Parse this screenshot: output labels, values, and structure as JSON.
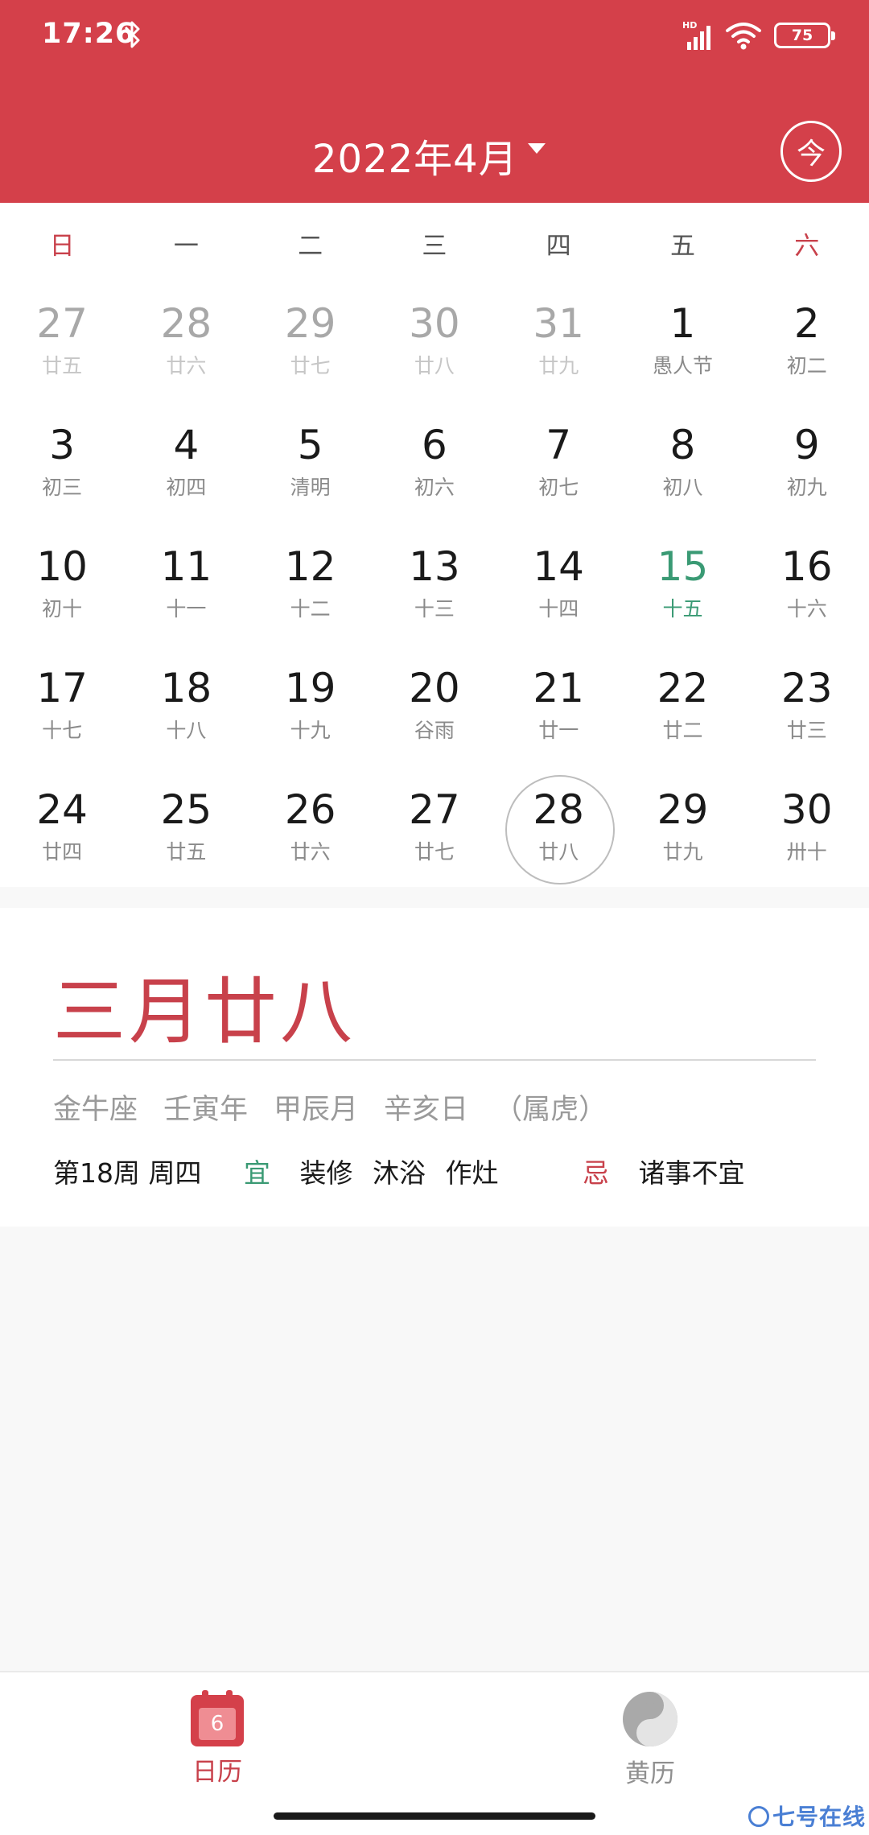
{
  "status_bar": {
    "time": "17:26",
    "network": "HD",
    "battery": "75"
  },
  "header": {
    "title": "2022年4月",
    "today_button": "今"
  },
  "weekdays": [
    "日",
    "一",
    "二",
    "三",
    "四",
    "五",
    "六"
  ],
  "days": [
    {
      "day": "27",
      "lunar": "廿五",
      "state": "prev"
    },
    {
      "day": "28",
      "lunar": "廿六",
      "state": "prev"
    },
    {
      "day": "29",
      "lunar": "廿七",
      "state": "prev"
    },
    {
      "day": "30",
      "lunar": "廿八",
      "state": "prev"
    },
    {
      "day": "31",
      "lunar": "廿九",
      "state": "prev"
    },
    {
      "day": "1",
      "lunar": "愚人节",
      "state": ""
    },
    {
      "day": "2",
      "lunar": "初二",
      "state": ""
    },
    {
      "day": "3",
      "lunar": "初三",
      "state": ""
    },
    {
      "day": "4",
      "lunar": "初四",
      "state": ""
    },
    {
      "day": "5",
      "lunar": "清明",
      "state": ""
    },
    {
      "day": "6",
      "lunar": "初六",
      "state": ""
    },
    {
      "day": "7",
      "lunar": "初七",
      "state": ""
    },
    {
      "day": "8",
      "lunar": "初八",
      "state": ""
    },
    {
      "day": "9",
      "lunar": "初九",
      "state": ""
    },
    {
      "day": "10",
      "lunar": "初十",
      "state": ""
    },
    {
      "day": "11",
      "lunar": "十一",
      "state": ""
    },
    {
      "day": "12",
      "lunar": "十二",
      "state": ""
    },
    {
      "day": "13",
      "lunar": "十三",
      "state": ""
    },
    {
      "day": "14",
      "lunar": "十四",
      "state": ""
    },
    {
      "day": "15",
      "lunar": "十五",
      "state": "today"
    },
    {
      "day": "16",
      "lunar": "十六",
      "state": ""
    },
    {
      "day": "17",
      "lunar": "十七",
      "state": ""
    },
    {
      "day": "18",
      "lunar": "十八",
      "state": ""
    },
    {
      "day": "19",
      "lunar": "十九",
      "state": ""
    },
    {
      "day": "20",
      "lunar": "谷雨",
      "state": ""
    },
    {
      "day": "21",
      "lunar": "廿一",
      "state": ""
    },
    {
      "day": "22",
      "lunar": "廿二",
      "state": ""
    },
    {
      "day": "23",
      "lunar": "廿三",
      "state": ""
    },
    {
      "day": "24",
      "lunar": "廿四",
      "state": ""
    },
    {
      "day": "25",
      "lunar": "廿五",
      "state": ""
    },
    {
      "day": "26",
      "lunar": "廿六",
      "state": ""
    },
    {
      "day": "27",
      "lunar": "廿七",
      "state": ""
    },
    {
      "day": "28",
      "lunar": "廿八",
      "state": "selected"
    },
    {
      "day": "29",
      "lunar": "廿九",
      "state": ""
    },
    {
      "day": "30",
      "lunar": "卅十",
      "state": ""
    }
  ],
  "detail": {
    "lunar_date": "三月廿八",
    "ganzhi": [
      "金牛座",
      "壬寅年",
      "甲辰月",
      "辛亥日",
      "（属虎）"
    ],
    "week_info": "第18周 周四",
    "yi_label": "宜",
    "yi_items": [
      "装修",
      "沐浴",
      "作灶"
    ],
    "ji_label": "忌",
    "ji_items": "诸事不宜"
  },
  "tabs": [
    {
      "label": "日历",
      "icon": "calendar-icon",
      "badge": "6",
      "active": true
    },
    {
      "label": "黄历",
      "icon": "yin-yang-icon",
      "active": false
    }
  ],
  "watermark": "七号在线",
  "colors": {
    "primary": "#d4404a",
    "today": "#3a9a74",
    "weekend": "#c8414b"
  }
}
